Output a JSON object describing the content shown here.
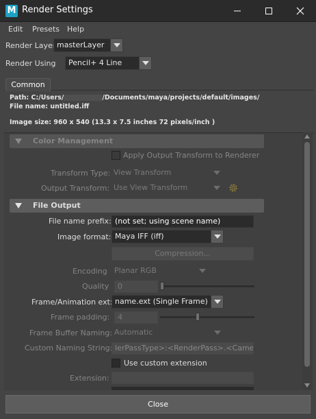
{
  "window": {
    "title": "Render Settings",
    "app_icon_letter": "M",
    "controls": {
      "minimize": "minimize-icon",
      "maximize": "maximize-icon",
      "close": "close-icon"
    }
  },
  "menu": [
    "Edit",
    "Presets",
    "Help"
  ],
  "render_layer": {
    "label": "Render Layer",
    "value": "masterLayer"
  },
  "render_using": {
    "label": "Render Using",
    "value": "Pencil+ 4 Line"
  },
  "tabs": [
    "Common"
  ],
  "info": {
    "path_prefix": "Path: C:/Users/",
    "path_suffix": "/Documents/maya/projects/default/images/",
    "file_name": "File name:  untitled.iff",
    "image_size": "Image size: 960 x 540 (13.3 x 7.5 inches 72 pixels/inch )"
  },
  "color_management": {
    "title": "Color Management",
    "apply_output_transform": "Apply Output Transform to Renderer",
    "transform_type_label": "Transform Type:",
    "transform_type_value": "View Transform",
    "output_transform_label": "Output Transform:",
    "output_transform_value": "Use View Transform"
  },
  "file_output": {
    "title": "File Output",
    "file_name_prefix_label": "File name prefix:",
    "file_name_prefix_value": "(not set; using scene name)",
    "image_format_label": "Image format:",
    "image_format_value": "Maya IFF (iff)",
    "compression_label": "Compression...",
    "encoding_label": "Encoding",
    "encoding_value": "Planar RGB",
    "quality_label": "Quality",
    "quality_value": "0",
    "frame_ext_label": "Frame/Animation ext:",
    "frame_ext_value": "name.ext (Single Frame)",
    "frame_padding_label": "Frame padding:",
    "frame_padding_value": "4",
    "frame_buffer_naming_label": "Frame Buffer Naming:",
    "frame_buffer_naming_value": "Automatic",
    "custom_naming_label": "Custom Naming String:",
    "custom_naming_value": "lerPassType>:<RenderPass>.<Camera>",
    "use_custom_extension": "Use custom extension",
    "extension_label": "Extension:"
  },
  "close_button": "Close"
}
